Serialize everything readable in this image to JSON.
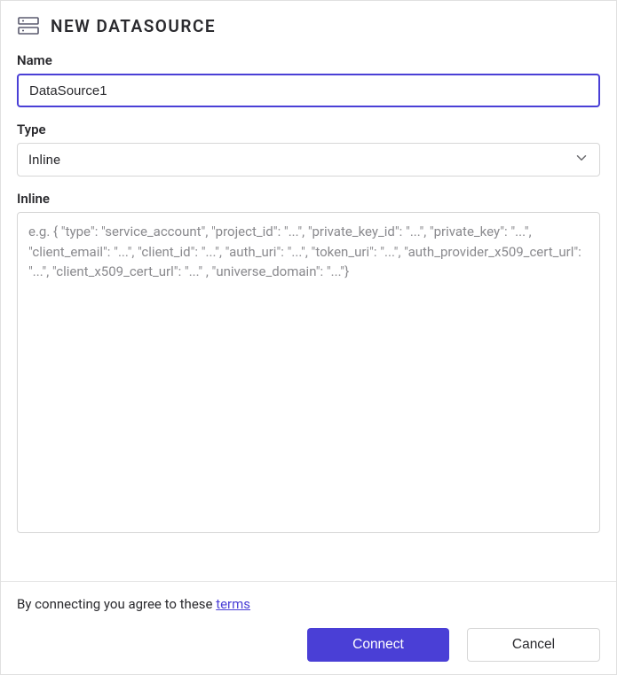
{
  "header": {
    "title": "NEW DATASOURCE"
  },
  "fields": {
    "name": {
      "label": "Name",
      "value": "DataSource1"
    },
    "type": {
      "label": "Type",
      "selected": "Inline"
    },
    "inline": {
      "label": "Inline",
      "value": "",
      "placeholder": "e.g. { \"type\": \"service_account\", \"project_id\": \"...\", \"private_key_id\": \"...\", \"private_key\": \"...\", \"client_email\": \"...\", \"client_id\": \"...\", \"auth_uri\": \"...\", \"token_uri\": \"...\", \"auth_provider_x509_cert_url\": \"...\", \"client_x509_cert_url\": \"...\" , \"universe_domain\": \"...\"}"
    }
  },
  "footer": {
    "agreement_text": "By connecting you agree to these ",
    "terms_label": "terms",
    "connect_label": "Connect",
    "cancel_label": "Cancel"
  }
}
